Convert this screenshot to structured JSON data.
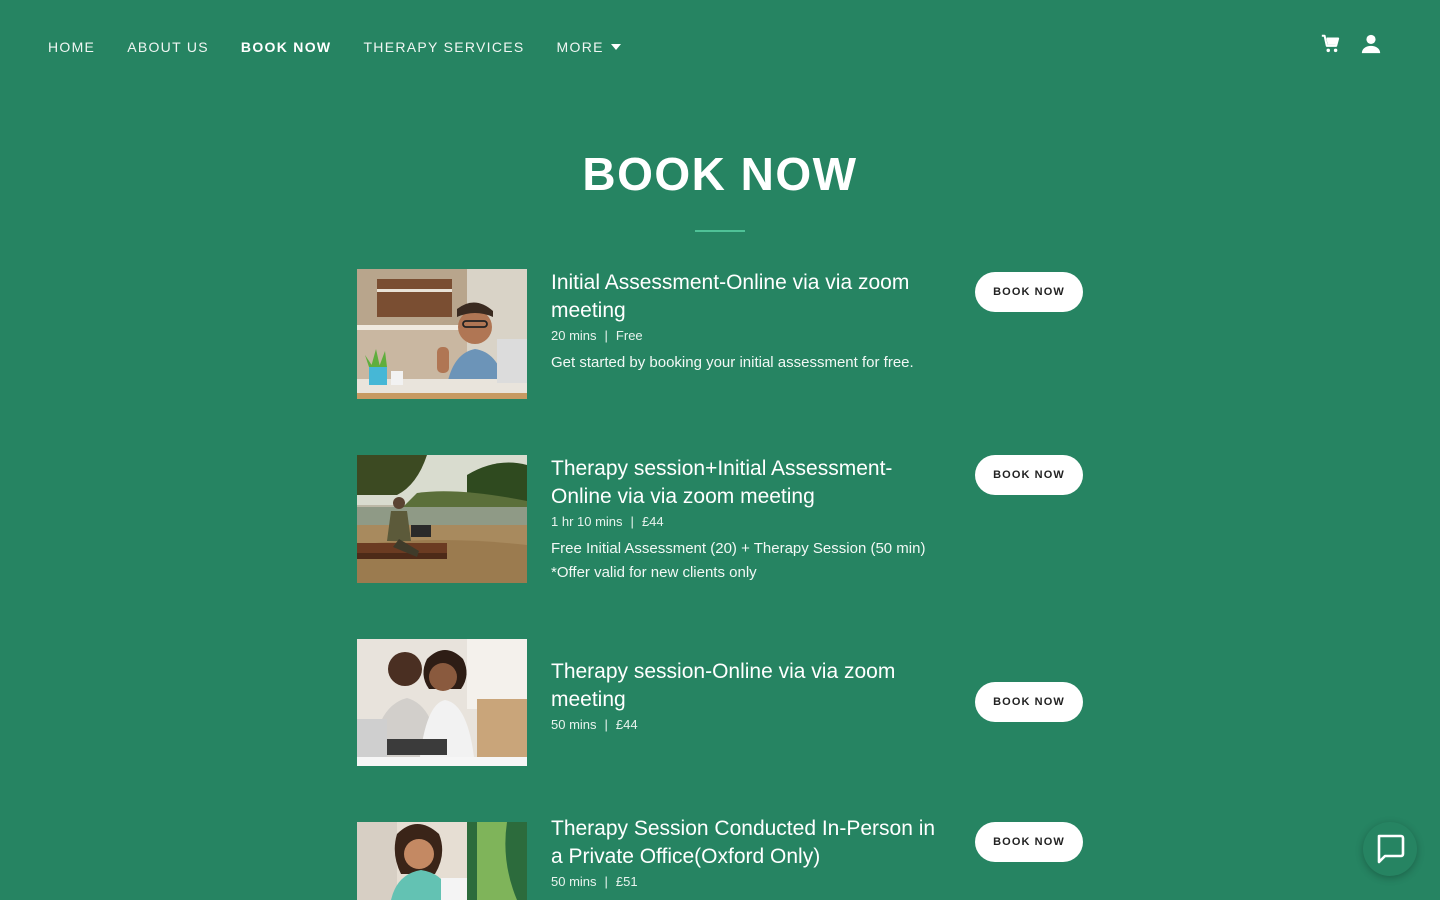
{
  "nav": {
    "items": [
      {
        "label": "HOME",
        "active": false
      },
      {
        "label": "ABOUT US",
        "active": false
      },
      {
        "label": "BOOK NOW",
        "active": true
      },
      {
        "label": "THERAPY SERVICES",
        "active": false
      }
    ],
    "more_label": "MORE",
    "icons": [
      "cart-icon",
      "user-icon"
    ]
  },
  "page": {
    "title": "BOOK NOW"
  },
  "services": [
    {
      "title": "Initial Assessment-Online via via zoom meeting",
      "duration": "20 mins",
      "price": "Free",
      "description": [
        "Get started by booking your initial assessment for free."
      ],
      "button": "BOOK NOW"
    },
    {
      "title": "Therapy session+Initial Assessment-Online via via zoom meeting",
      "duration": "1 hr 10 mins",
      "price": "£44",
      "description": [
        "Free Initial Assessment (20) + Therapy Session (50 min)",
        "*Offer valid for new clients only"
      ],
      "button": "BOOK NOW"
    },
    {
      "title": "Therapy session-Online via via zoom meeting",
      "duration": "50 mins",
      "price": "£44",
      "description": [],
      "button": "BOOK NOW"
    },
    {
      "title": "Therapy Session Conducted In-Person in a Private Office(Oxford Only)",
      "duration": "50 mins",
      "price": "£51",
      "description": [],
      "button": "BOOK NOW"
    }
  ],
  "meta_separator": "|",
  "colors": {
    "background": "#268462",
    "accent_rule": "#4fc297",
    "button_bg": "#ffffff",
    "button_text": "#222222"
  }
}
